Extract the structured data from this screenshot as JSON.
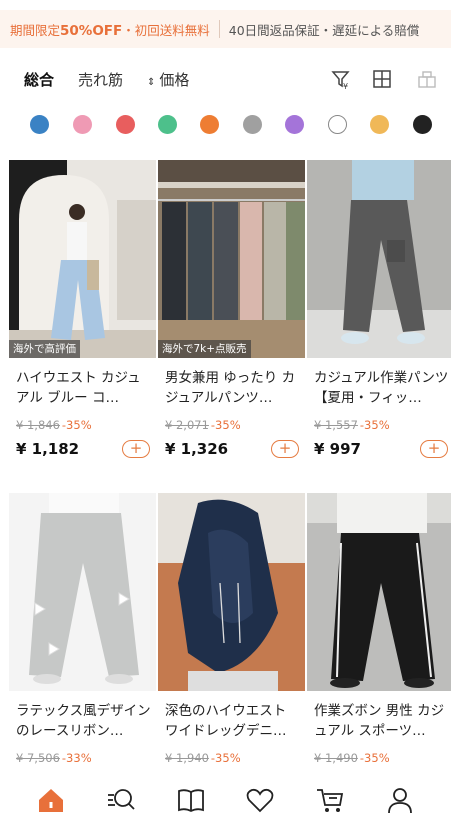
{
  "promo": {
    "label": "期間限定",
    "discount": "50%OFF",
    "shipping": "・初回送料無料",
    "guarantee": "40日間返品保証・遅延による賠償"
  },
  "sort": {
    "items": [
      "総合",
      "売れ筋",
      "価格"
    ],
    "active": "総合"
  },
  "color_filters": [
    "#3a82c4",
    "#ef9ab4",
    "#e85e5e",
    "#4dc08b",
    "#ee7d33",
    "#a0a0a0",
    "#a474d9",
    "#ffffff",
    "#f0b858",
    "#222222"
  ],
  "products": [
    {
      "badge": "海外で高評価",
      "title": "ハイウエスト カジュアル ブルー コ…",
      "original_price": "¥ 1,846",
      "discount": "-35%",
      "price": "¥ 1,182"
    },
    {
      "badge": "海外で7k+点販売",
      "title": "男女兼用 ゆったり カジュアルパンツ…",
      "original_price": "¥ 2,071",
      "discount": "-35%",
      "price": "¥ 1,326"
    },
    {
      "badge": "",
      "title": "カジュアル作業パンツ【夏用・フィッ…",
      "original_price": "¥ 1,557",
      "discount": "-35%",
      "price": "¥ 997"
    },
    {
      "badge": "",
      "title": "ラテックス風デザインのレースリボン…",
      "original_price": "¥ 7,506",
      "discount": "-33%",
      "price": ""
    },
    {
      "badge": "",
      "title": "深色のハイウエスト ワイドレッグデニ…",
      "original_price": "¥ 1,940",
      "discount": "-35%",
      "price": ""
    },
    {
      "badge": "",
      "title": "作業ズボン 男性 カジュアル スポーツ…",
      "original_price": "¥ 1,490",
      "discount": "-35%",
      "price": ""
    }
  ],
  "bottom_nav": [
    "home-icon",
    "search-icon",
    "book-icon",
    "heart-icon",
    "cart-icon",
    "profile-icon"
  ],
  "accent_color": "#e8703a"
}
